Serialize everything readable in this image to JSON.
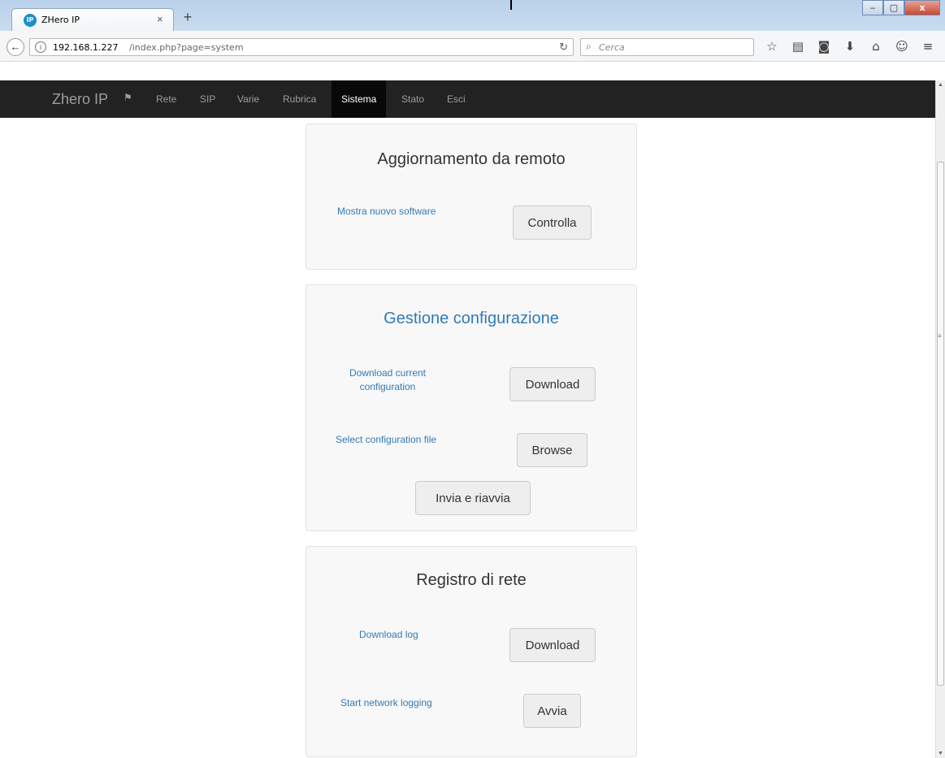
{
  "browser": {
    "tab_title": "ZHero IP",
    "tab_close": "×",
    "new_tab": "+",
    "favicon_text": "IP",
    "url_host": "192.168.1.227",
    "url_path": "/index.php?page=system",
    "search_placeholder": "Cerca",
    "window_controls": {
      "minimize": "‒",
      "maximize": "▢",
      "close": "x"
    }
  },
  "nav": {
    "brand": "Zhero IP",
    "items": [
      {
        "label": "Rete"
      },
      {
        "label": "SIP"
      },
      {
        "label": "Varie"
      },
      {
        "label": "Rubrica"
      },
      {
        "label": "Sistema",
        "active": true
      },
      {
        "label": "Stato"
      },
      {
        "label": "Esci"
      }
    ]
  },
  "remote_update": {
    "title": "Aggiornamento da remoto",
    "show_label": "Mostra nuovo software",
    "check_button": "Controlla"
  },
  "config": {
    "title": "Gestione configurazione",
    "download_label_1": "Download current",
    "download_label_2": "configuration",
    "download_button": "Download",
    "select_label": "Select configuration file",
    "browse_button": "Browse",
    "send_button": "Invia e riavvia"
  },
  "netlog": {
    "title": "Registro di rete",
    "download_label": "Download log",
    "download_button": "Download",
    "start_label": "Start network logging",
    "start_button": "Avvia"
  },
  "colors": {
    "navbar_bg": "#222222",
    "nav_active_bg": "#080808",
    "link_blue": "#337ab7",
    "panel_bg": "#f8f8f8"
  }
}
